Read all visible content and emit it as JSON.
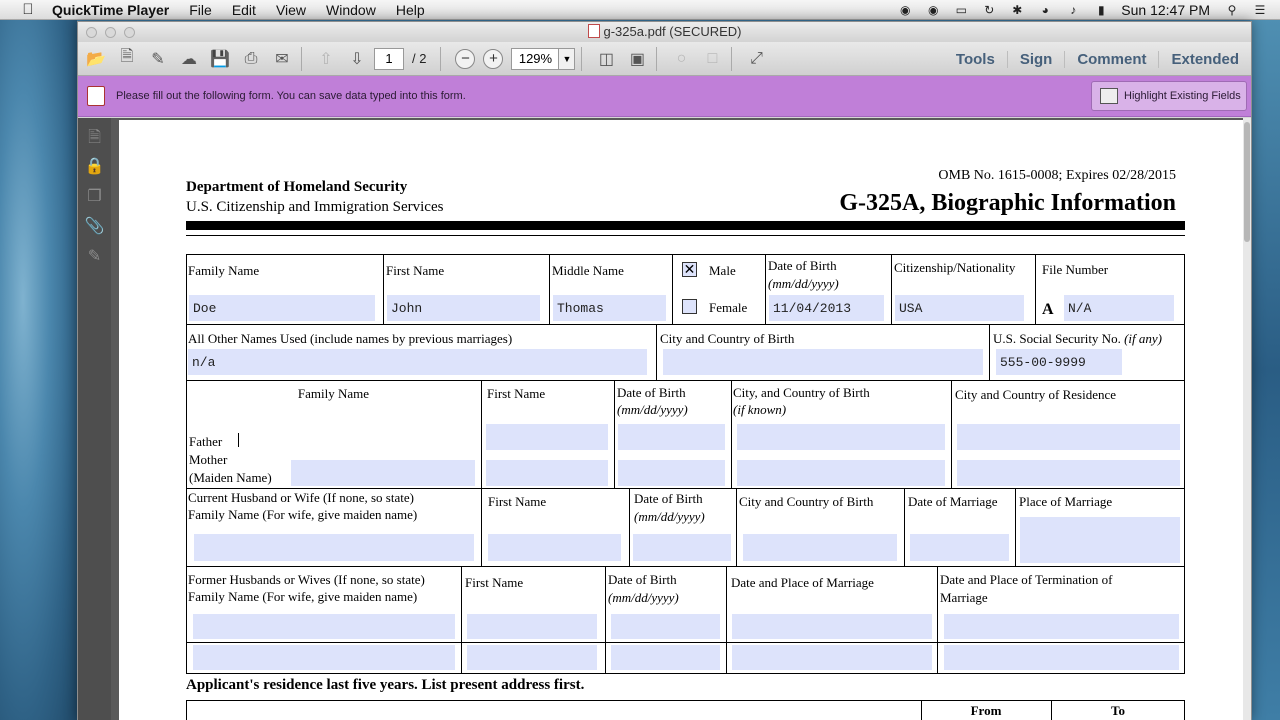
{
  "menubar": {
    "app_name": "QuickTime Player",
    "menus": [
      "File",
      "Edit",
      "View",
      "Window",
      "Help"
    ],
    "clock": "Sun 12:47 PM"
  },
  "window": {
    "title": "g-325a.pdf (SECURED)"
  },
  "toolbar": {
    "page_current": "1",
    "page_total": "/ 2",
    "zoom": "129%",
    "links": [
      "Tools",
      "Sign",
      "Comment",
      "Extended"
    ]
  },
  "formbar": {
    "message": "Please fill out the following form. You can save data typed into this form.",
    "highlight_label": "Highlight Existing Fields"
  },
  "form": {
    "omb": "OMB No. 1615-0008; Expires 02/28/2015",
    "dept": "Department of Homeland Security",
    "agency": "U.S. Citizenship and Immigration Services",
    "title": "G-325A, Biographic Information",
    "labels": {
      "family_name": "Family Name",
      "first_name": "First Name",
      "middle_name": "Middle Name",
      "male": "Male",
      "female": "Female",
      "dob": "Date of Birth",
      "dob_fmt": "(mm/dd/yyyy)",
      "citizenship": "Citizenship/Nationality",
      "file_number": "File Number",
      "file_prefix": "A",
      "other_names": "All Other Names Used (include names by previous marriages)",
      "city_country_birth": "City and Country of Birth",
      "ssn": "U.S. Social Security No.",
      "ssn_note": "(if any)",
      "parents_family": "Family Name",
      "parents_first": "First Name",
      "parents_dob": "Date of Birth",
      "parents_city_birth": "City, and Country of Birth",
      "if_known": "(if known)",
      "parents_residence": "City and Country of Residence",
      "father": "Father",
      "mother": "Mother",
      "maiden": "(Maiden Name)",
      "spouse_line1": "Current Husband or Wife (If none, so state)",
      "spouse_line2": "Family Name (For wife, give maiden name)",
      "spouse_first": "First Name",
      "spouse_dob": "Date of Birth",
      "spouse_city_birth": "City and Country of Birth",
      "spouse_dom": "Date of Marriage",
      "spouse_pom": "Place of Marriage",
      "former_line1": "Former Husbands or Wives (If none, so state)",
      "former_line2": "Family Name (For wife, give maiden name)",
      "former_first": "First Name",
      "former_dob": "Date of Birth",
      "former_dpm": "Date and Place of Marriage",
      "former_dpt1": "Date and Place of Termination of",
      "former_dpt2": "Marriage",
      "residence_heading": "Applicant's residence last five years.  List present address first.",
      "from": "From",
      "to": "To"
    },
    "values": {
      "family_name": "Doe",
      "first_name": "John",
      "middle_name": "Thomas",
      "male_checked": "✕",
      "dob": "11/04/2013",
      "citizenship": "USA",
      "file_number": "N/A",
      "other_names": "n/a",
      "ssn": "555-00-9999"
    }
  }
}
